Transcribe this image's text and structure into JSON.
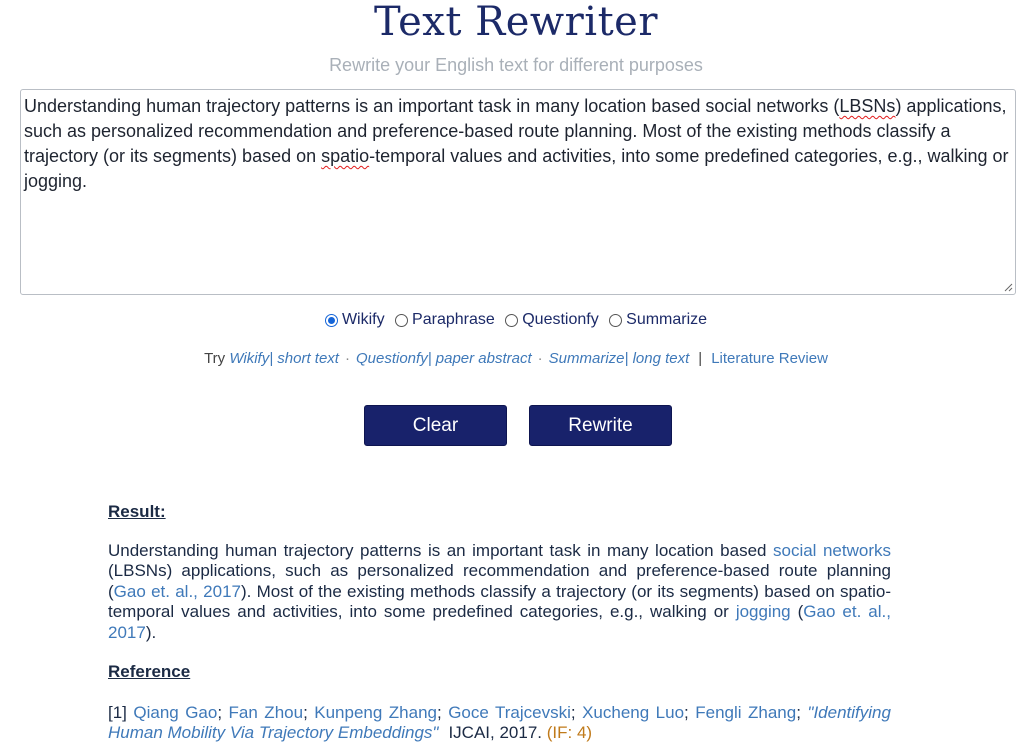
{
  "app": {
    "title": "Text Rewriter",
    "subtitle": "Rewrite your English text for different purposes"
  },
  "input": {
    "part1": "Understanding human trajectory patterns is an important task in many location based social networks (",
    "lbsns": "LBSNs",
    "part2": ") applications, such as personalized recommendation and preference-based route planning. Most of the existing methods classify a trajectory (or its segments) based on ",
    "spatio": "spatio",
    "part3": "-temporal values and activities, into some predefined categories, e.g., walking or jogging."
  },
  "modes": [
    {
      "label": "Wikify",
      "checked": true
    },
    {
      "label": "Paraphrase",
      "checked": false
    },
    {
      "label": "Questionfy",
      "checked": false
    },
    {
      "label": "Summarize",
      "checked": false
    }
  ],
  "try": {
    "prefix": "Try",
    "ex1_mode": "Wikify",
    "ex1_text": "| short text",
    "ex2_mode": "Questionfy",
    "ex2_text": "| paper abstract",
    "ex3_mode": "Summarize",
    "ex3_text": "| long text",
    "sep": "·",
    "bar": "|",
    "literature": "Literature Review"
  },
  "buttons": {
    "clear": "Clear",
    "rewrite": "Rewrite"
  },
  "result": {
    "heading": "Result:",
    "t1": "Understanding human trajectory patterns is an important task in many location based ",
    "link_social_networks": "social networks",
    "t2": " (LBSNs) applications, such as personalized recommendation and preference-based route planning (",
    "cite1": "Gao et. al., 2017",
    "t3": "). Most of the existing methods classify a trajectory (or its segments) based on spatio-temporal values and activities, into some predefined categories, e.g., walking or ",
    "link_jogging": "jogging",
    "t4": " (",
    "cite2": "Gao et. al., 2017",
    "t5": ")."
  },
  "reference": {
    "heading": "Reference",
    "index": "[1]",
    "authors": [
      "Qiang Gao",
      "Fan Zhou",
      "Kunpeng Zhang",
      "Goce Trajcevski",
      "Xucheng Luo",
      "Fengli Zhang"
    ],
    "author_sep": ";",
    "paper": "\"Identifying Human Mobility Via Trajectory Embeddings\"",
    "venue": "IJCAI,",
    "year": "2017.",
    "impact": "(IF: 4)"
  },
  "colors": {
    "brand": "#18226b",
    "link": "#3f79b9",
    "impact": "#c07a1a",
    "spellcheck": "#e21b1b"
  }
}
